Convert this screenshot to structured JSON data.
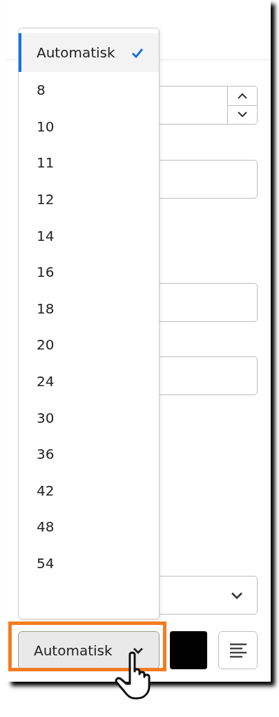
{
  "size_menu": {
    "options": [
      {
        "label": "Automatisk",
        "selected": true
      },
      {
        "label": "8",
        "selected": false
      },
      {
        "label": "10",
        "selected": false
      },
      {
        "label": "11",
        "selected": false
      },
      {
        "label": "12",
        "selected": false
      },
      {
        "label": "14",
        "selected": false
      },
      {
        "label": "16",
        "selected": false
      },
      {
        "label": "18",
        "selected": false
      },
      {
        "label": "20",
        "selected": false
      },
      {
        "label": "24",
        "selected": false
      },
      {
        "label": "30",
        "selected": false
      },
      {
        "label": "36",
        "selected": false
      },
      {
        "label": "42",
        "selected": false
      },
      {
        "label": "48",
        "selected": false
      },
      {
        "label": "54",
        "selected": false
      }
    ]
  },
  "toolbar": {
    "size_button": {
      "label": "Automatisk",
      "highlighted": true
    }
  }
}
